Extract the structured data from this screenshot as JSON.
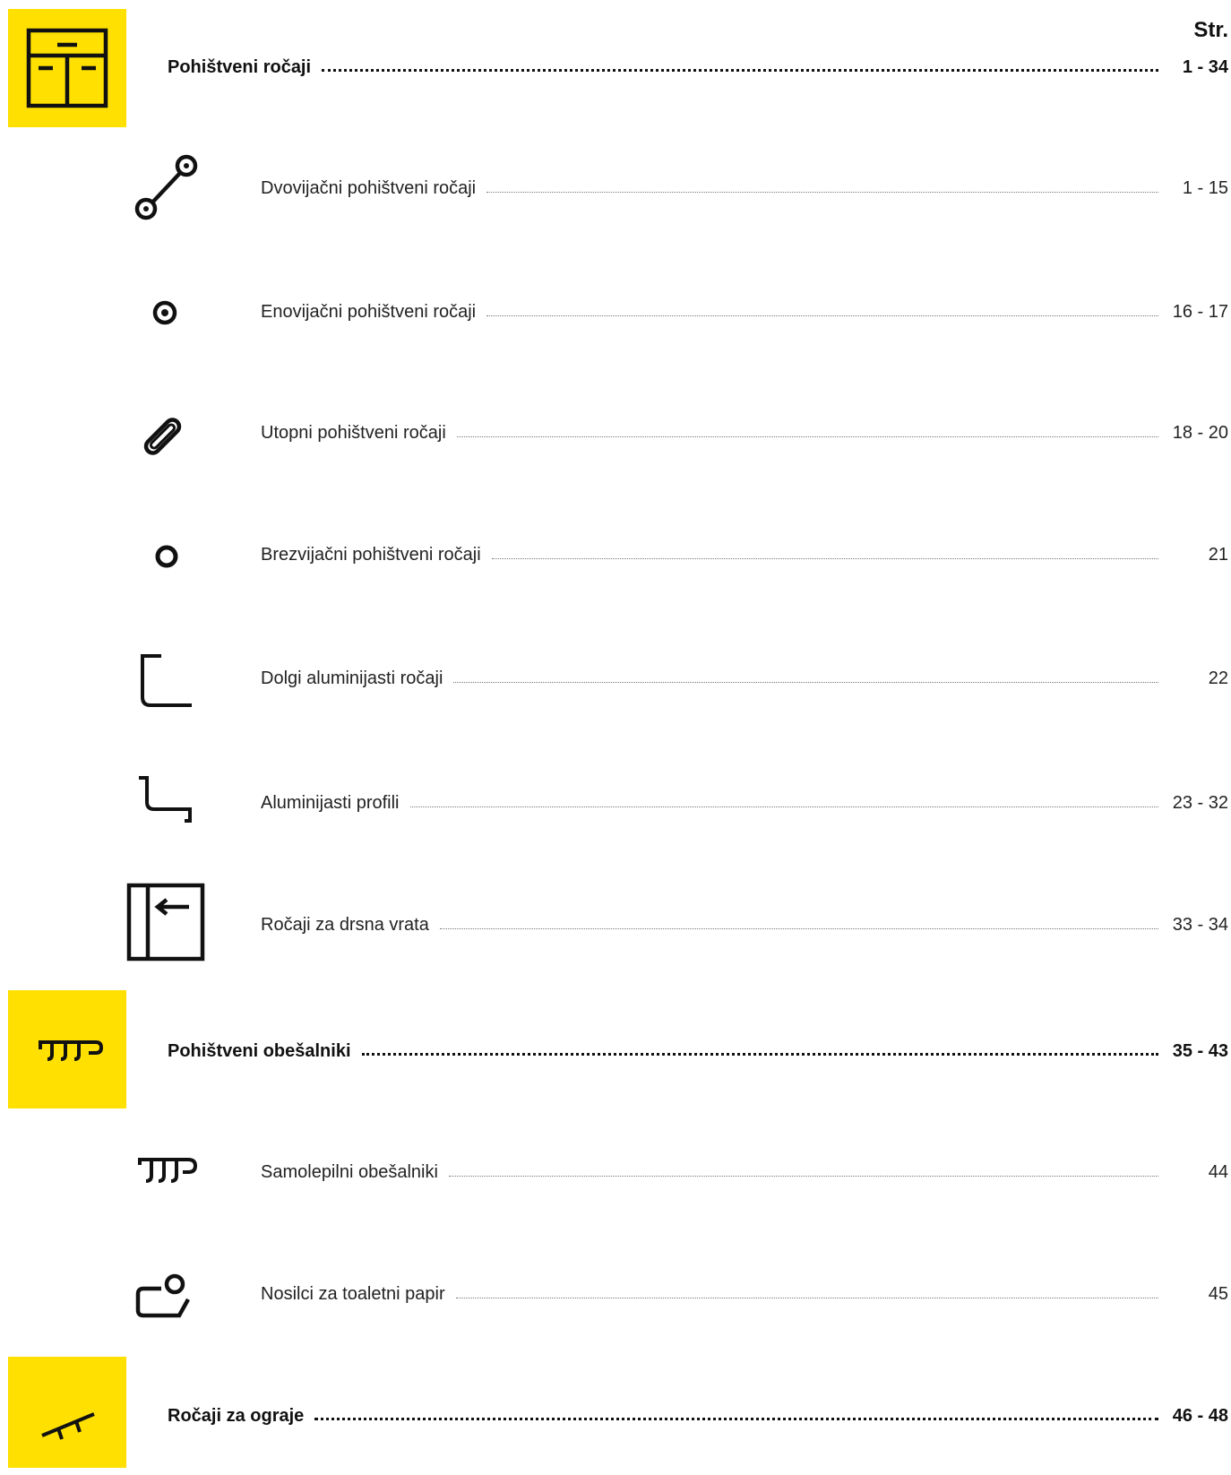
{
  "header": {
    "page_col": "Str."
  },
  "sections": [
    {
      "title": "Pohištveni ročaji",
      "pages": "1 - 34",
      "icon": "cabinet-icon"
    },
    {
      "title": "Pohištveni obešalniki",
      "pages": "35 - 43",
      "icon": "coat-hook-icon"
    },
    {
      "title": "Ročaji za ograje",
      "pages": "46 - 48",
      "icon": "railing-icon"
    }
  ],
  "items": [
    {
      "label": "Dvovijačni pohištveni ročaji",
      "pages": "1 - 15",
      "icon": "two-screw-handle-icon"
    },
    {
      "label": "Enovijačni pohištveni ročaji",
      "pages": "16 - 17",
      "icon": "knob-icon"
    },
    {
      "label": "Utopni pohištveni ročaji",
      "pages": "18 - 20",
      "icon": "recessed-handle-icon"
    },
    {
      "label": "Brezvijačni pohištveni ročaji",
      "pages": "21",
      "icon": "ring-icon"
    },
    {
      "label": "Dolgi aluminijasti ročaji",
      "pages": "22",
      "icon": "long-profile-icon"
    },
    {
      "label": "Aluminijasti profili",
      "pages": "23 - 32",
      "icon": "aluminium-profile-icon"
    },
    {
      "label": "Ročaji za drsna vrata",
      "pages": "33 - 34",
      "icon": "sliding-door-icon"
    },
    {
      "label": "Samolepilni obešalniki",
      "pages": "44",
      "icon": "adhesive-hook-icon"
    },
    {
      "label": "Nosilci za toaletni papir",
      "pages": "45",
      "icon": "toilet-paper-holder-icon"
    }
  ],
  "colors": {
    "accent": "#FFE000",
    "text": "#1a1a1a"
  }
}
